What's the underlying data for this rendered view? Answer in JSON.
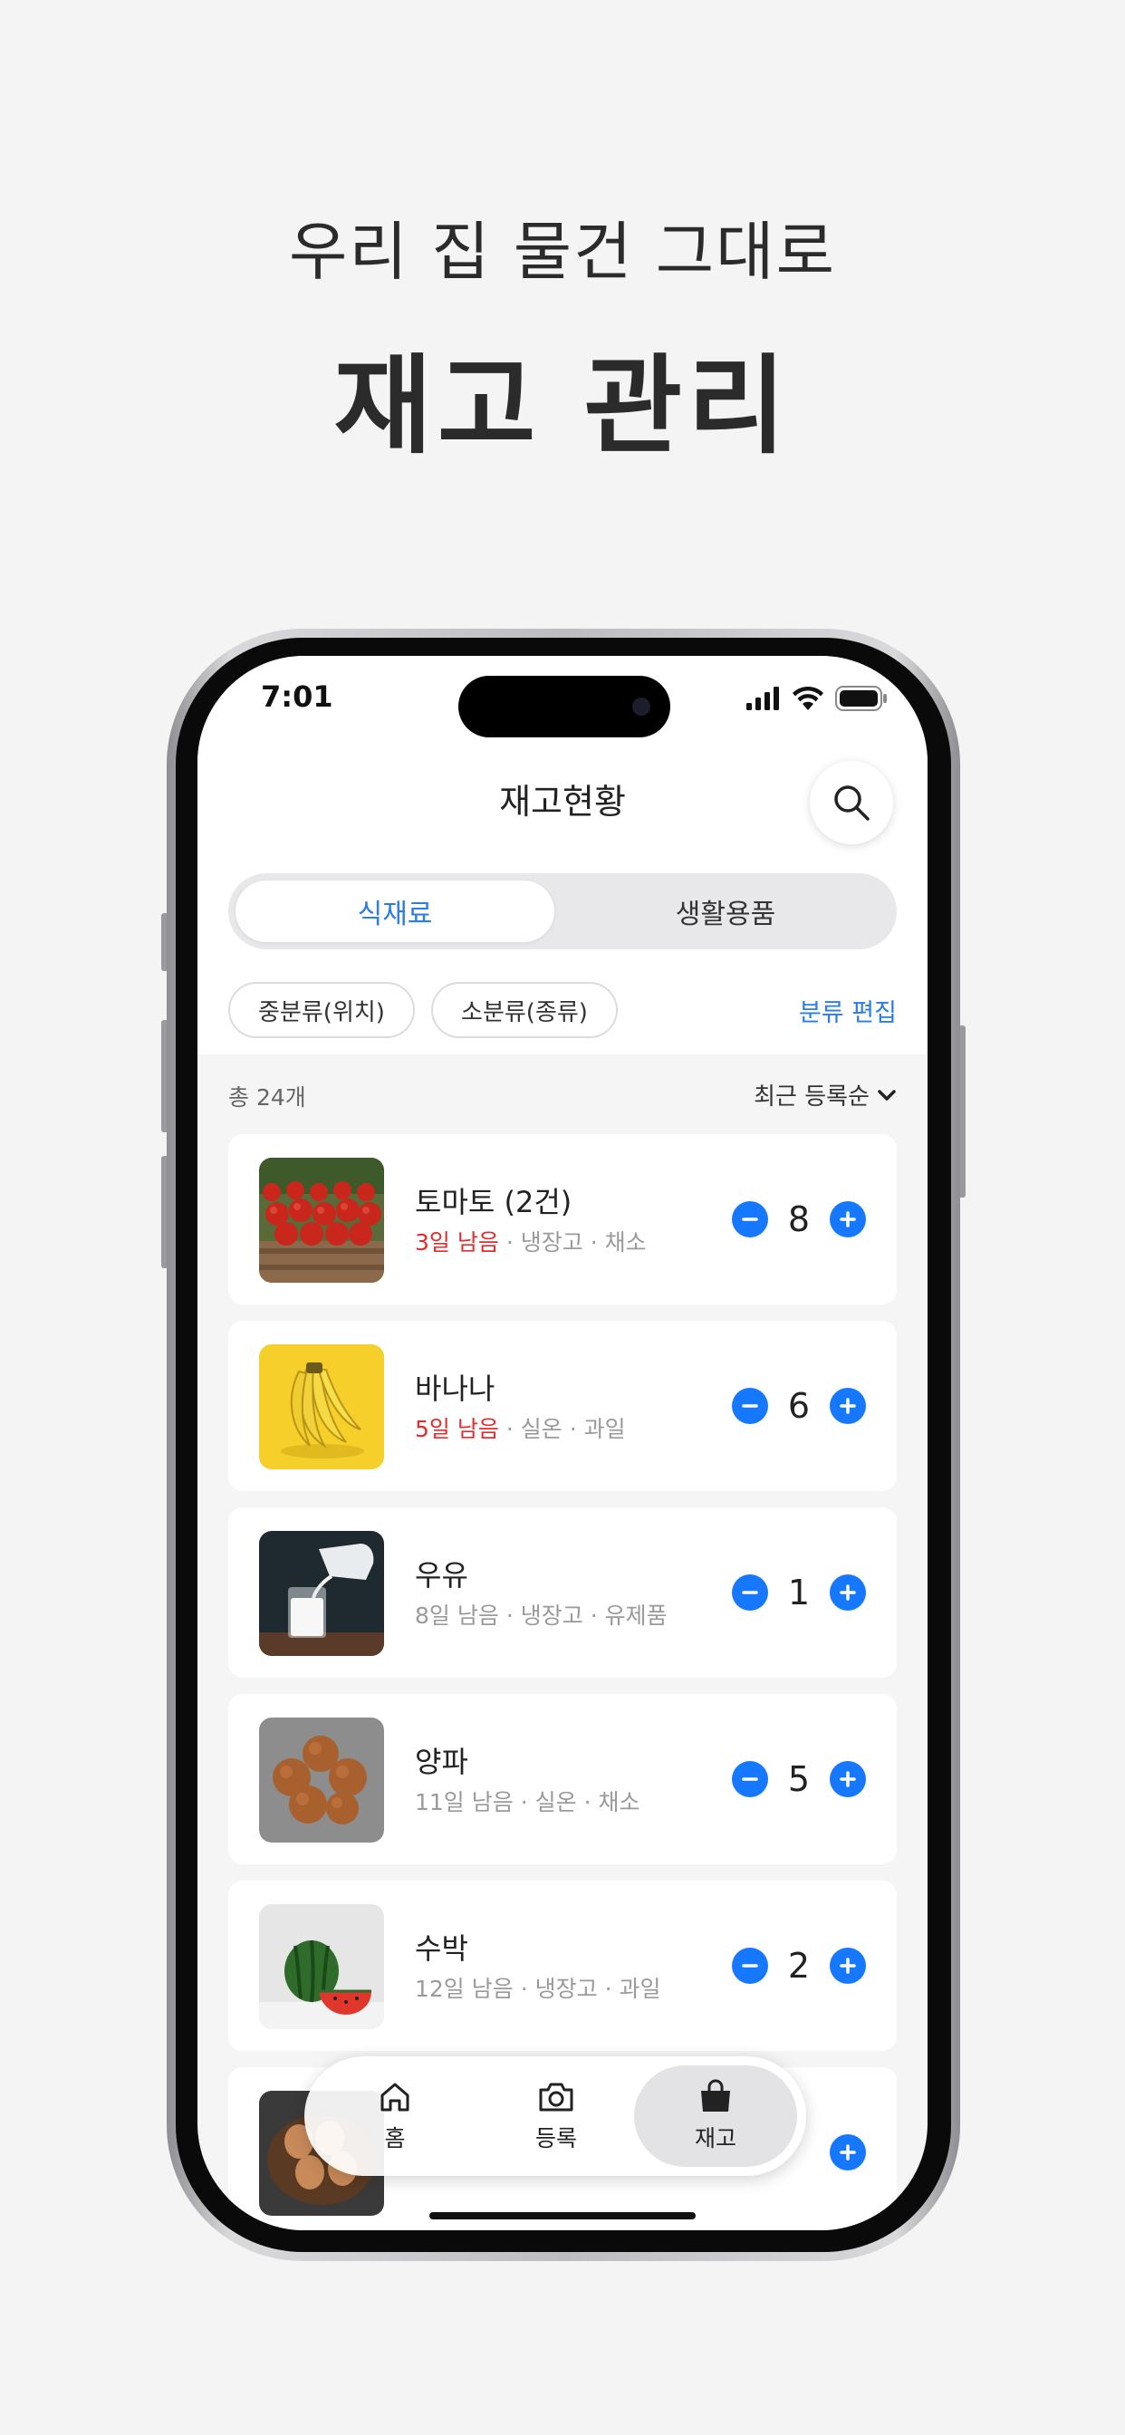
{
  "promo": {
    "subtitle": "우리 집 물건 그대로",
    "title": "재고 관리"
  },
  "status_bar": {
    "time": "7:01",
    "icons": [
      "signal-icon",
      "wifi-icon",
      "battery-icon"
    ]
  },
  "header": {
    "title": "재고현황",
    "search_icon": "search-icon"
  },
  "segmented": {
    "tabs": [
      {
        "label": "식재료",
        "active": true
      },
      {
        "label": "생활용품",
        "active": false
      }
    ]
  },
  "filters": {
    "chips": [
      "중분류(위치)",
      "소분류(종류)"
    ],
    "edit_label": "분류 편집"
  },
  "summary": {
    "total": "총 24개",
    "sort": "최근 등록순"
  },
  "items": [
    {
      "name": "토마토 (2건)",
      "days": "3일 남음",
      "urgent": true,
      "location": "냉장고",
      "category": "채소",
      "qty": "8",
      "image": "tomatoes"
    },
    {
      "name": "바나나",
      "days": "5일 남음",
      "urgent": true,
      "location": "실온",
      "category": "과일",
      "qty": "6",
      "image": "bananas"
    },
    {
      "name": "우유",
      "days": "8일 남음",
      "urgent": false,
      "location": "냉장고",
      "category": "유제품",
      "qty": "1",
      "image": "milk"
    },
    {
      "name": "양파",
      "days": "11일 남음",
      "urgent": false,
      "location": "실온",
      "category": "채소",
      "qty": "5",
      "image": "onions"
    },
    {
      "name": "수박",
      "days": "12일 남음",
      "urgent": false,
      "location": "냉장고",
      "category": "과일",
      "qty": "2",
      "image": "watermelon"
    }
  ],
  "tab_bar": {
    "tabs": [
      {
        "label": "홈",
        "icon": "home-icon",
        "active": false
      },
      {
        "label": "등록",
        "icon": "camera-icon",
        "active": false
      },
      {
        "label": "재고",
        "icon": "bag-icon",
        "active": true
      }
    ]
  },
  "colors": {
    "accent": "#1677ff",
    "urgent": "#e12d2d",
    "background": "#f4f4f4"
  }
}
